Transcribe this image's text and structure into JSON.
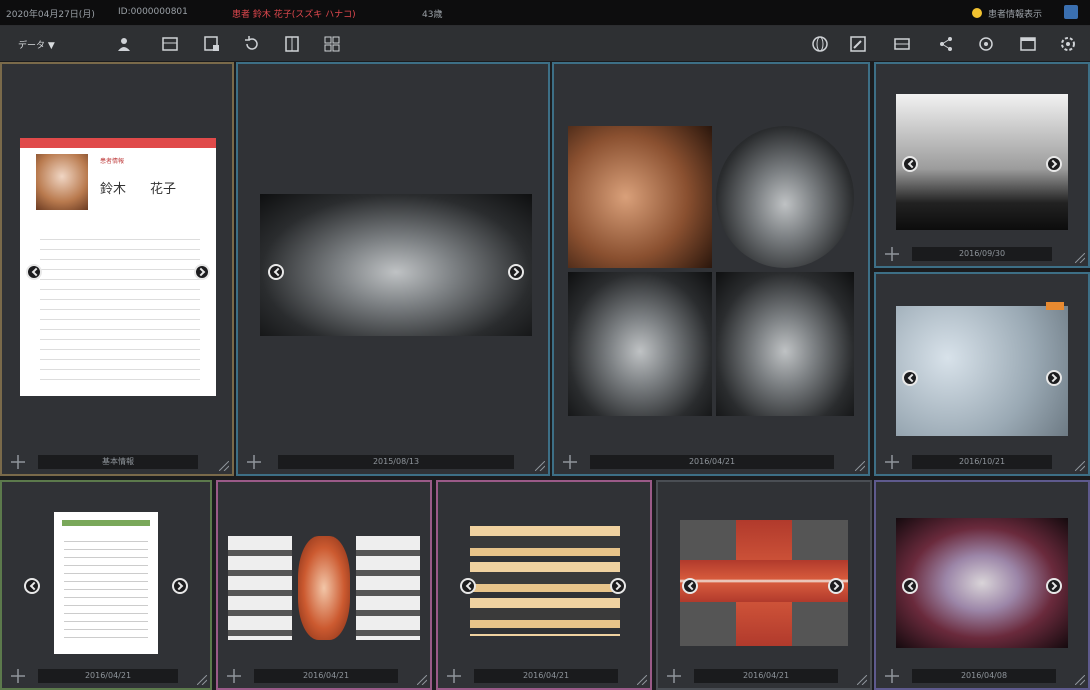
{
  "topbar": {
    "date": "2020年04月27日(月)",
    "patient_id": "ID:0000000801",
    "patient_name_label": "患者 鈴木 花子(スズキ ハナコ)",
    "age": "43歳",
    "status": "患者情報表示"
  },
  "toolbar": {
    "menu_label": "データ ▼",
    "icons": [
      "person-icon",
      "list-icon",
      "import-icon",
      "rotate-icon",
      "layout-icon",
      "grid-icon"
    ],
    "right_icons": [
      "globe-icon",
      "edit-icon",
      "scanner-icon",
      "share-icon",
      "zoom-icon",
      "window-icon",
      "settings-icon"
    ]
  },
  "patient_card": {
    "header": "患者情報",
    "family_name": "鈴木",
    "given_name": "花子"
  },
  "panels": [
    {
      "id": "p1",
      "label": "基本情報"
    },
    {
      "id": "p2",
      "label": "2015/08/13"
    },
    {
      "id": "p3",
      "label": "2016/04/21"
    },
    {
      "id": "p4",
      "label": "2016/09/30"
    },
    {
      "id": "p5",
      "label": "2016/10/21"
    },
    {
      "id": "p6",
      "label": "2016/04/21"
    },
    {
      "id": "p7",
      "label": "2016/04/21"
    },
    {
      "id": "p8",
      "label": "2016/04/21"
    },
    {
      "id": "p9",
      "label": "2016/04/21"
    },
    {
      "id": "p10",
      "label": "2016/04/08"
    }
  ],
  "colors": {
    "accent": "#3d6f86",
    "brown": "#7a6a4a",
    "green": "#5c7a4c",
    "pink": "#9a5a88",
    "violet": "#5e5a8e",
    "alert": "#e0484e"
  }
}
